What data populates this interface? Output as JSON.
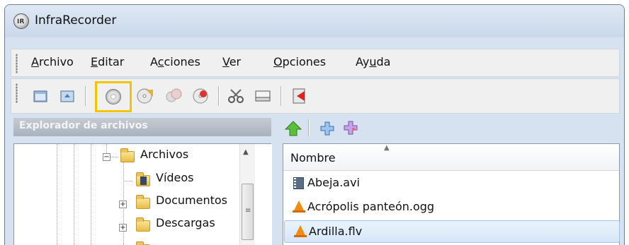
{
  "window": {
    "title": "InfraRecorder"
  },
  "menubar": {
    "items": [
      {
        "label": "Archivo",
        "mnemonic": "A",
        "rest": "rchivo"
      },
      {
        "label": "Editar",
        "mnemonic": "E",
        "rest": "ditar"
      },
      {
        "label": "Acciones",
        "pre": "A",
        "mnemonic": "c",
        "rest": "ciones"
      },
      {
        "label": "Ver",
        "mnemonic": "V",
        "rest": "er"
      },
      {
        "label": "Opciones",
        "mnemonic": "O",
        "rest": "pciones"
      },
      {
        "label": "Ayuda",
        "pre": "Ay",
        "mnemonic": "u",
        "rest": "da"
      }
    ]
  },
  "toolbar": {
    "buttons": [
      {
        "icon": "new-project-icon"
      },
      {
        "icon": "open-project-icon"
      },
      {
        "icon": "burn-image-icon",
        "highlighted": true
      },
      {
        "icon": "copy-disc-icon"
      },
      {
        "icon": "erase-disc-icon"
      },
      {
        "icon": "fixate-disc-icon"
      },
      {
        "icon": "tracks-icon"
      },
      {
        "icon": "disc-info-icon"
      },
      {
        "icon": "exit-icon"
      }
    ],
    "highlight_color": "#f5c400"
  },
  "explorer": {
    "header": "Explorador de archivos",
    "tree": [
      {
        "label": "Archivos",
        "expander": "minus"
      },
      {
        "label": "Vídeos"
      },
      {
        "label": "Documentos",
        "expander": "plus"
      },
      {
        "label": "Descargas",
        "expander": "plus"
      }
    ]
  },
  "file_toolbar": {
    "buttons": [
      {
        "icon": "up-folder-icon"
      },
      {
        "icon": "add-icon"
      },
      {
        "icon": "add-all-icon"
      }
    ]
  },
  "file_list": {
    "columns": [
      "Nombre"
    ],
    "rows": [
      {
        "name": "Abeja.avi",
        "icon": "video-file-icon"
      },
      {
        "name": "Acrópolis panteón.ogg",
        "icon": "vlc-icon"
      },
      {
        "name": "Ardilla.flv",
        "icon": "vlc-icon",
        "selected": true
      }
    ]
  },
  "colors": {
    "window_frame": "#d6e2f0",
    "toolbar_bg": "#f0f0f0",
    "selection": "#d6e7f9"
  }
}
